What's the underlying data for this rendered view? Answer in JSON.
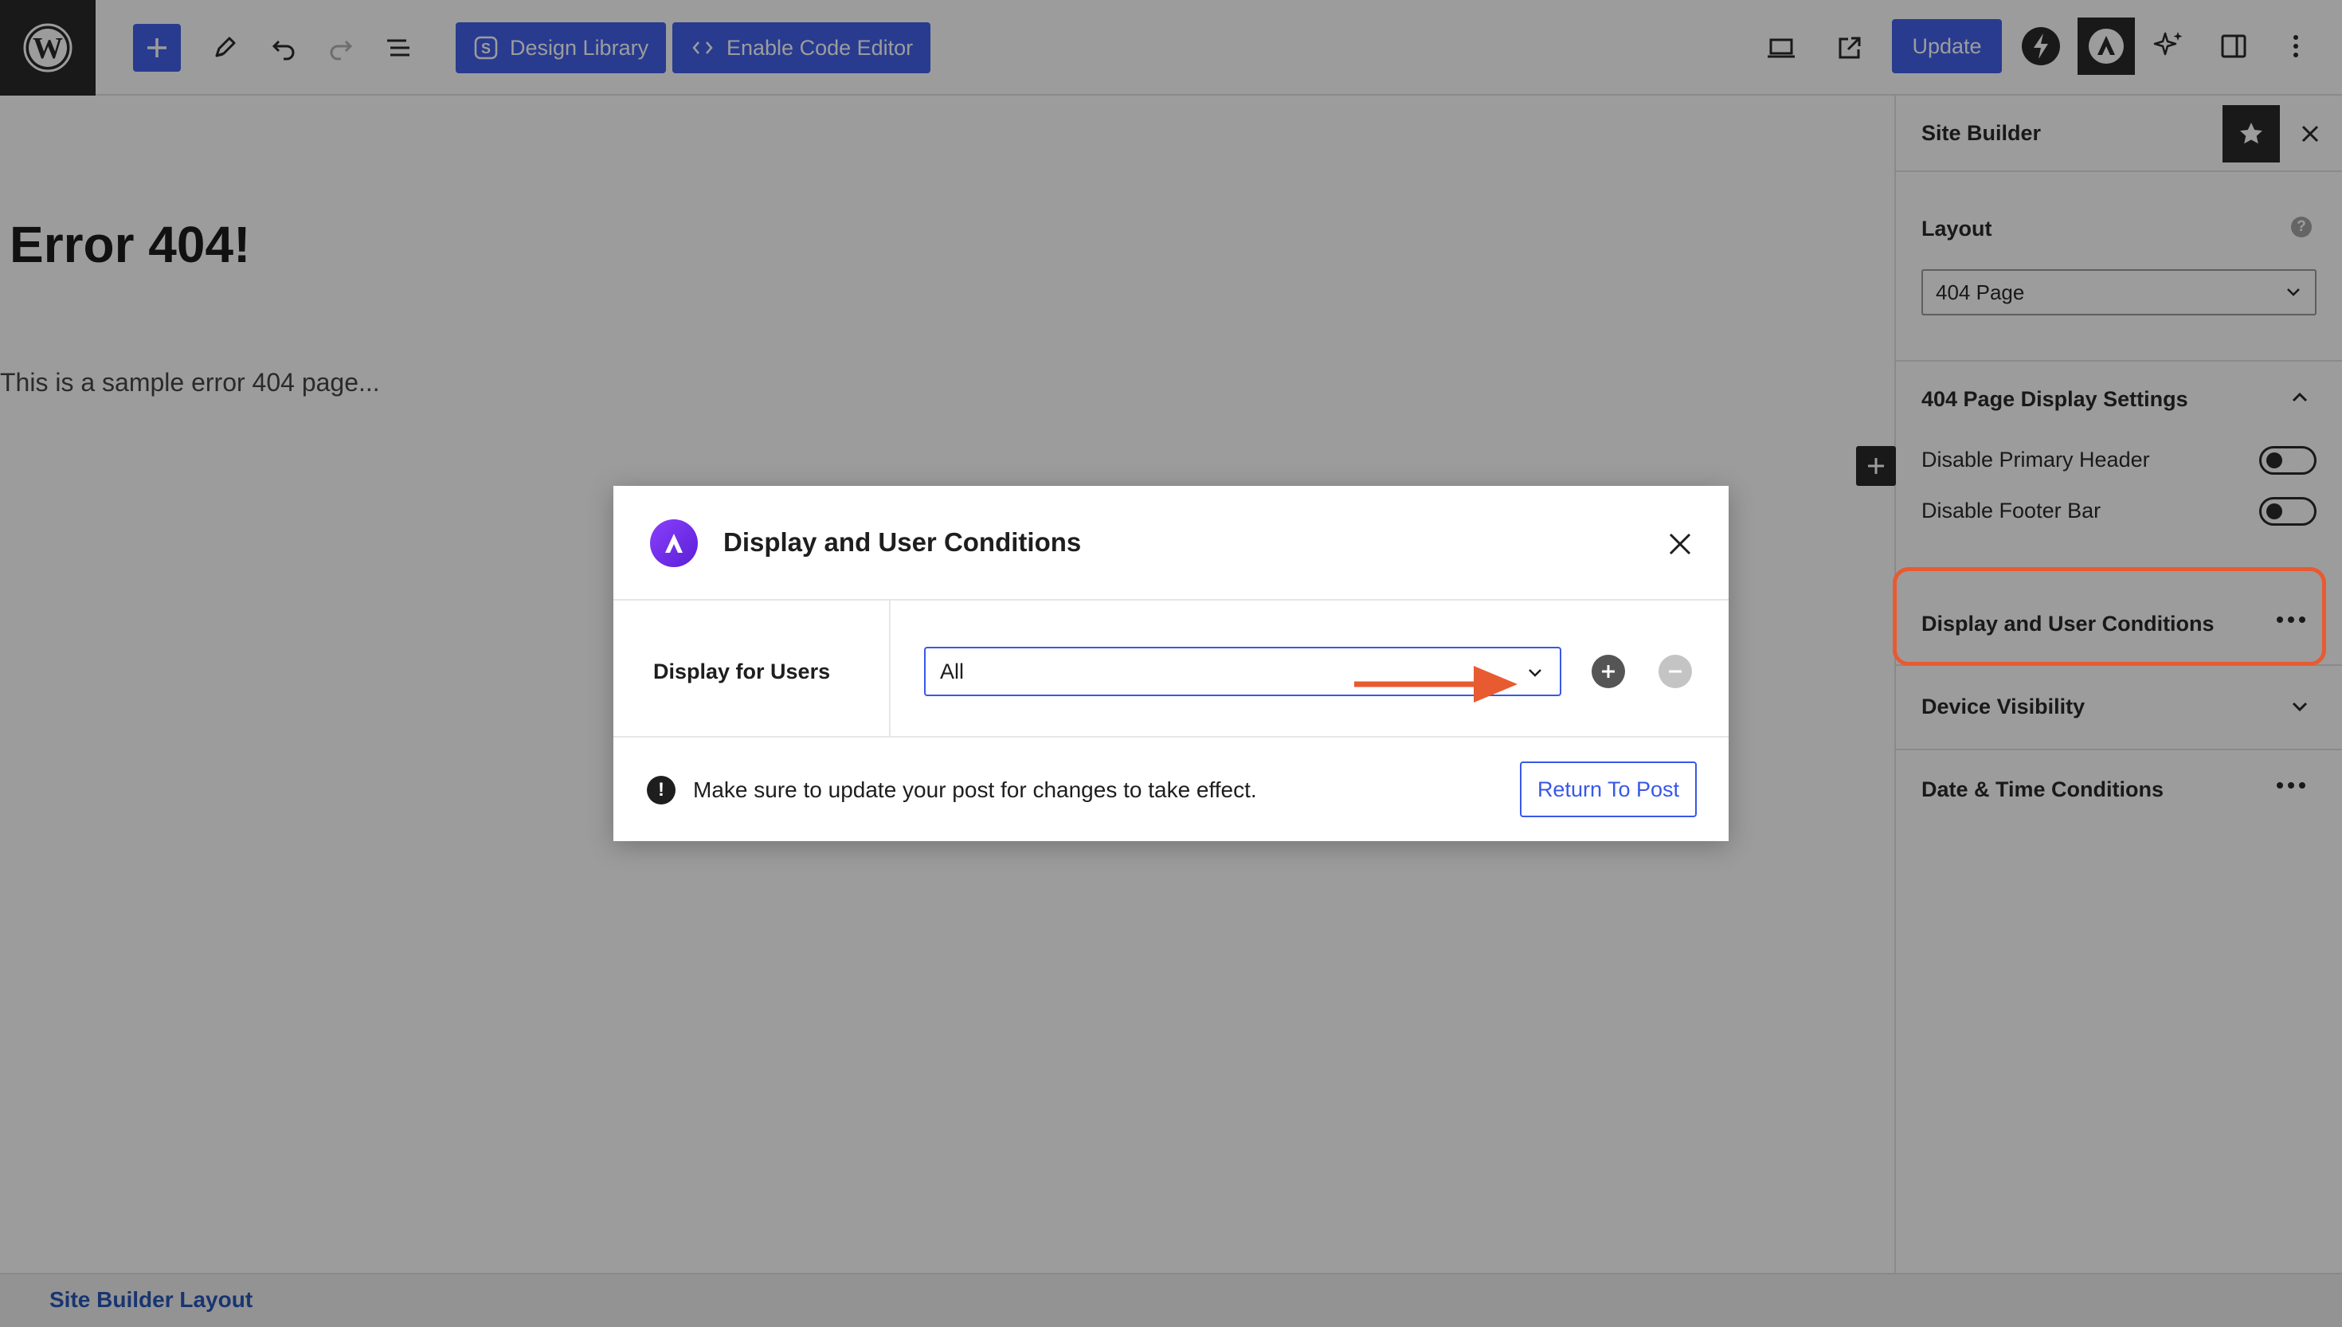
{
  "toolbar": {
    "design_library_label": "Design Library",
    "code_editor_label": "Enable Code Editor",
    "update_label": "Update"
  },
  "canvas": {
    "title": "Error 404!",
    "text": "This is a sample error 404 page..."
  },
  "sidebar": {
    "title": "Site Builder",
    "layout_label": "Layout",
    "layout_value": "404 Page",
    "help_glyph": "?",
    "display_settings_title": "404 Page Display Settings",
    "toggles": [
      {
        "label": "Disable Primary Header",
        "on": false
      },
      {
        "label": "Disable Footer Bar",
        "on": false
      }
    ],
    "sections": [
      {
        "label": "Display and User Conditions"
      },
      {
        "label": "Device Visibility"
      },
      {
        "label": "Date & Time Conditions"
      }
    ]
  },
  "modal": {
    "title": "Display and User Conditions",
    "row_label": "Display for Users",
    "select_value": "All",
    "notice_glyph": "!",
    "notice": "Make sure to update your post for changes to take effect.",
    "return_label": "Return To Post"
  },
  "footer": {
    "label": "Site Builder Layout"
  },
  "colors": {
    "accent": "#3858e9",
    "annotation": "#e85a30",
    "dark": "#1e1e1e",
    "overlay": "rgba(20,20,20,0.42)"
  }
}
